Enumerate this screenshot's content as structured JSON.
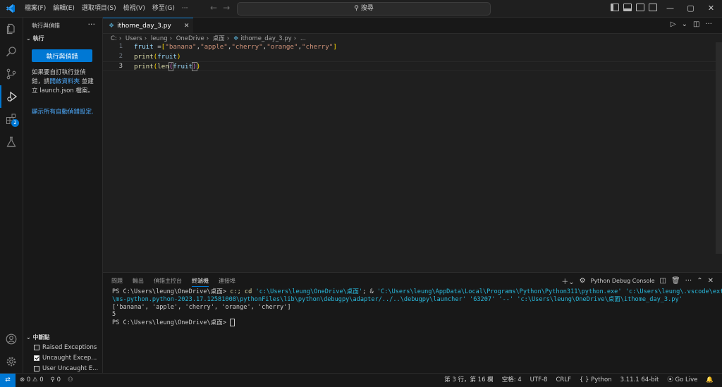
{
  "titlebar": {
    "menus": [
      "檔案(F)",
      "編輯(E)",
      "選取項目(S)",
      "檢視(V)",
      "移至(G)",
      "···"
    ],
    "search_text": "搜尋",
    "window_controls": [
      "—",
      "▢",
      "✕"
    ]
  },
  "sidebar": {
    "title": "執行與偵錯",
    "more": "···",
    "section_run": "執行",
    "run_button": "執行與偵錯",
    "help_prefix": "如果要自訂執行並偵錯，請",
    "help_link": "開啟資料夾",
    "help_suffix": " 並建立 launch.json 檔案。",
    "show_all_link": "顯示所有自動偵錯設定.",
    "breakpoints_section": "中斷點",
    "breakpoints": [
      {
        "label": "Raised Exceptions",
        "checked": false
      },
      {
        "label": "Uncaught Excep...",
        "checked": true
      },
      {
        "label": "User Uncaught E...",
        "checked": false
      }
    ]
  },
  "editor": {
    "tab_label": "ithome_day_3.py",
    "breadcrumb": [
      "C:",
      "Users",
      "leung",
      "OneDrive",
      "桌面",
      "ithome_day_3.py",
      "..."
    ],
    "line_numbers": [
      "1",
      "2",
      "3"
    ]
  },
  "panel": {
    "tabs": [
      "問題",
      "輸出",
      "偵錯主控台",
      "終端機",
      "連接埠"
    ],
    "active_tab": "終端機",
    "console_label": "Python Debug Console",
    "terminal": {
      "line1_prompt": "PS C:\\Users\\leung\\OneDrive\\桌面> ",
      "line1_cmd": "c:; cd ",
      "line1_arg1": "'c:\\Users\\leung\\OneDrive\\桌面'",
      "line1_mid": "; & ",
      "line1_arg2": "'C:\\Users\\leung\\AppData\\Local\\Programs\\Python\\Python311\\python.exe' 'c:\\Users\\leung\\.vscode\\extensions",
      "line2": "\\ms-python.python-2023.17.12581008\\pythonFiles\\lib\\python\\debugpy\\adapter/../..\\debugpy\\launcher' '63207' '--' 'c:\\Users\\leung\\OneDrive\\桌面\\ithome_day_3.py'",
      "output1": "['banana', 'apple', 'cherry', 'orange', 'cherry']",
      "output2": "5",
      "prompt2": "PS C:\\Users\\leung\\OneDrive\\桌面> "
    }
  },
  "statusbar": {
    "remote": "⇄",
    "problems": "⊗ 0 ⚠ 0",
    "ports": "⚲ 0",
    "position": "第 3 行，第 16 欄",
    "spaces": "空格: 4",
    "encoding": "UTF-8",
    "eol": "CRLF",
    "language": "Python",
    "interpreter": "3.11.1 64-bit",
    "golive": "Go Live"
  },
  "colors": {
    "accent": "#0078d4",
    "string": "#ce9178",
    "function": "#dcdcaa",
    "variable": "#9cdcfe"
  }
}
